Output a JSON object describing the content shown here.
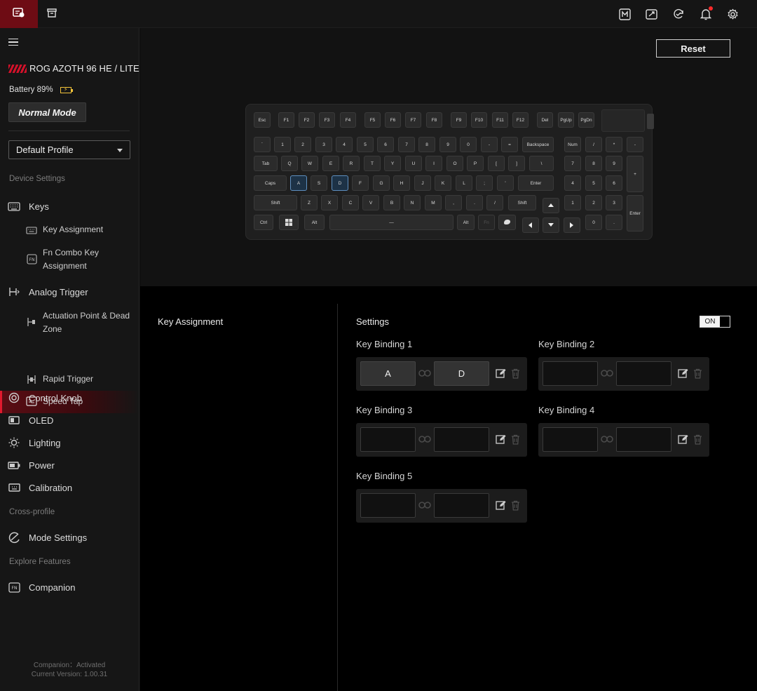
{
  "sidebar": {
    "device_name": "ROG AZOTH 96 HE / LITE",
    "battery_text": "Battery 89%",
    "mode_label": "Normal Mode",
    "profile": "Default Profile",
    "sections": {
      "device_settings": "Device Settings",
      "cross_profile": "Cross-profile",
      "explore_features": "Explore Features"
    },
    "items": {
      "keys": "Keys",
      "key_assignment": "Key Assignment",
      "fn_combo": "Fn Combo Key Assignment",
      "analog_trigger": "Analog Trigger",
      "actuation": "Actuation Point & Dead Zone",
      "rapid_trigger": "Rapid Trigger",
      "speed_tap": "Speed Tap",
      "control_knob": "Control Knob",
      "oled": "OLED",
      "lighting": "Lighting",
      "power": "Power",
      "calibration": "Calibration",
      "mode_settings": "Mode Settings",
      "companion": "Companion"
    },
    "footer": {
      "companion_status": "Companion：Activated",
      "version": "Current Version: 1.00.31"
    }
  },
  "toolbar": {
    "reset_label": "Reset"
  },
  "keyboard": {
    "selected_keys": [
      "A",
      "D"
    ],
    "rows": {
      "f": [
        "Esc",
        "F1",
        "F2",
        "F3",
        "F4",
        "F5",
        "F6",
        "F7",
        "F8",
        "F9",
        "F10",
        "F11",
        "F12",
        "Del",
        "PgUp",
        "PgDn"
      ],
      "num": [
        "`",
        "1",
        "2",
        "3",
        "4",
        "5",
        "6",
        "7",
        "8",
        "9",
        "0",
        "-",
        "=",
        "Backspace",
        "Num",
        "/",
        "*",
        "-"
      ],
      "q": [
        "Tab",
        "Q",
        "W",
        "E",
        "R",
        "T",
        "Y",
        "U",
        "I",
        "O",
        "P",
        "[",
        "]",
        "\\",
        "7",
        "8",
        "9",
        "+"
      ],
      "a": [
        "Caps",
        "A",
        "S",
        "D",
        "F",
        "G",
        "H",
        "J",
        "K",
        "L",
        ";",
        "'",
        "Enter",
        "4",
        "5",
        "6"
      ],
      "z": [
        "Shift",
        "Z",
        "X",
        "C",
        "V",
        "B",
        "N",
        "M",
        ",",
        ".",
        "/",
        "Shift",
        "1",
        "2",
        "3",
        "Enter"
      ],
      "b": [
        "Ctrl",
        "",
        "Alt",
        "—",
        "Alt",
        "Fn",
        "",
        "0",
        "."
      ]
    }
  },
  "panel": {
    "left_title": "Key Assignment",
    "settings_title": "Settings",
    "toggle_label": "ON",
    "toggle_on": true,
    "bindings": [
      {
        "label": "Key Binding 1",
        "key1": "A",
        "key2": "D"
      },
      {
        "label": "Key Binding 2",
        "key1": "",
        "key2": ""
      },
      {
        "label": "Key Binding 3",
        "key1": "",
        "key2": ""
      },
      {
        "label": "Key Binding 4",
        "key1": "",
        "key2": ""
      },
      {
        "label": "Key Binding 5",
        "key1": "",
        "key2": ""
      }
    ]
  },
  "colors": {
    "accent": "#e01a2e",
    "active_tab": "#6e0c14",
    "selected_key": "#5e8fbf",
    "battery": "#f3c43a"
  }
}
